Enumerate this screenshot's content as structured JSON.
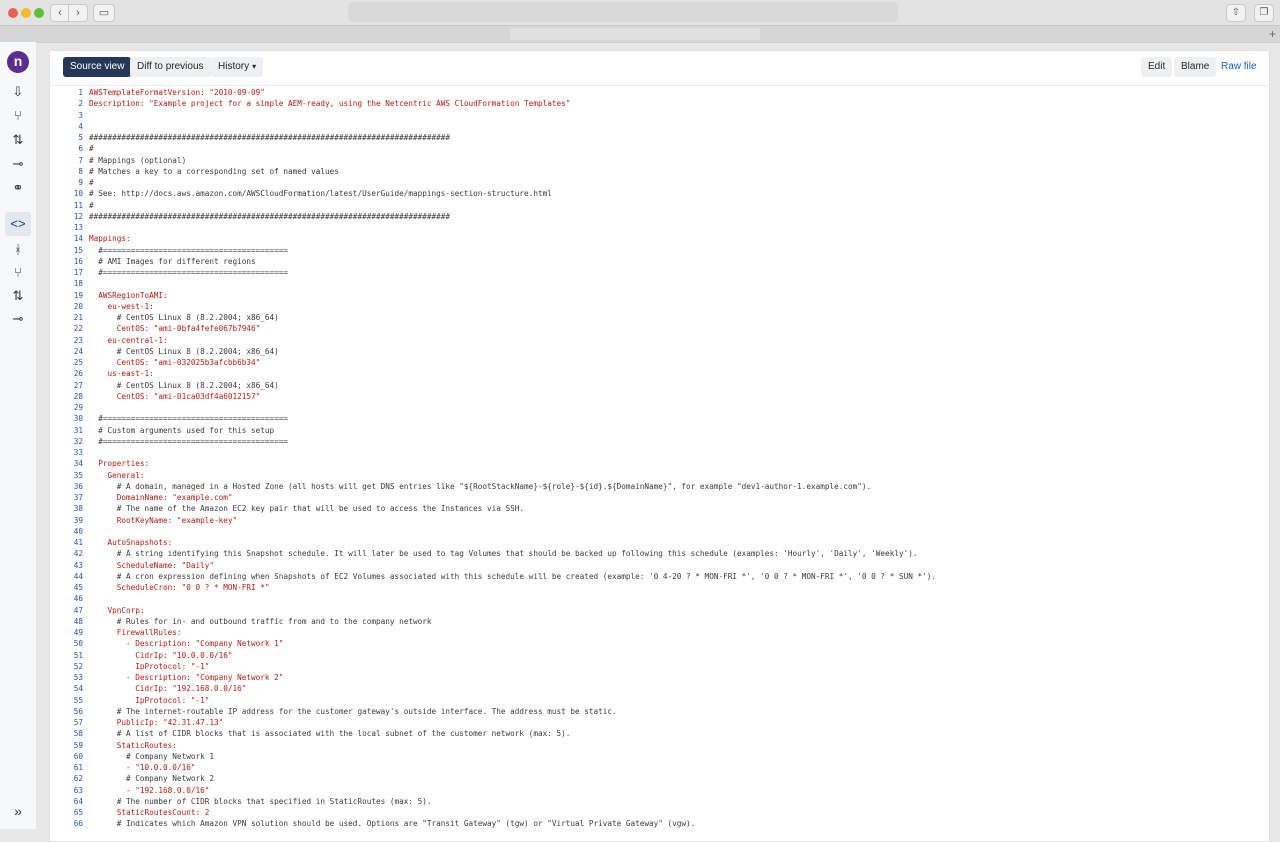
{
  "toolbar": {
    "source_view": "Source view",
    "diff_to_previous": "Diff to previous",
    "history": "History",
    "edit": "Edit",
    "blame": "Blame",
    "raw_file": "Raw file"
  },
  "sidebar": {
    "logo": "n",
    "expand": "»"
  },
  "code_lines": [
    {
      "n": "1",
      "t": "AWSTemplateFormatVersion: \"2010-09-09\"",
      "s": "k"
    },
    {
      "n": "2",
      "t": "Description: \"Example project for a simple AEM-ready, using the Netcentric AWS CloudFormation Templates\"",
      "s": "k"
    },
    {
      "n": "3",
      "t": "",
      "s": "c"
    },
    {
      "n": "4",
      "t": "",
      "s": "c"
    },
    {
      "n": "5",
      "t": "##############################################################################",
      "s": "c"
    },
    {
      "n": "6",
      "t": "#",
      "s": "c"
    },
    {
      "n": "7",
      "t": "# Mappings (optional)",
      "s": "c"
    },
    {
      "n": "8",
      "t": "# Matches a key to a corresponding set of named values",
      "s": "c"
    },
    {
      "n": "9",
      "t": "#",
      "s": "c"
    },
    {
      "n": "10",
      "t": "# See: http://docs.aws.amazon.com/AWSCloudFormation/latest/UserGuide/mappings-section-structure.html",
      "s": "c"
    },
    {
      "n": "11",
      "t": "#",
      "s": "c"
    },
    {
      "n": "12",
      "t": "##############################################################################",
      "s": "c"
    },
    {
      "n": "13",
      "t": "",
      "s": "c"
    },
    {
      "n": "14",
      "t": "Mappings:",
      "s": "k"
    },
    {
      "n": "15",
      "t": "  #========================================",
      "s": "c"
    },
    {
      "n": "16",
      "t": "  # AMI Images for different regions",
      "s": "c"
    },
    {
      "n": "17",
      "t": "  #========================================",
      "s": "c"
    },
    {
      "n": "18",
      "t": "",
      "s": "c"
    },
    {
      "n": "19",
      "t": "  AWSRegionToAMI:",
      "s": "k"
    },
    {
      "n": "20",
      "t": "    eu-west-1:",
      "s": "k"
    },
    {
      "n": "21",
      "t": "      # CentOS Linux 8 (8.2.2004; x86_64)",
      "s": "c"
    },
    {
      "n": "22",
      "t": "      CentOS: \"ami-0bfa4fefe067b7946\"",
      "s": "k"
    },
    {
      "n": "23",
      "t": "    eu-central-1:",
      "s": "k"
    },
    {
      "n": "24",
      "t": "      # CentOS Linux 8 (8.2.2004; x86_64)",
      "s": "c"
    },
    {
      "n": "25",
      "t": "      CentOS: \"ami-032025b3afcbb6b34\"",
      "s": "k"
    },
    {
      "n": "26",
      "t": "    us-east-1:",
      "s": "k"
    },
    {
      "n": "27",
      "t": "      # CentOS Linux 8 (8.2.2004; x86_64)",
      "s": "c"
    },
    {
      "n": "28",
      "t": "      CentOS: \"ami-01ca03df4a6012157\"",
      "s": "k"
    },
    {
      "n": "29",
      "t": "",
      "s": "c"
    },
    {
      "n": "30",
      "t": "  #========================================",
      "s": "c"
    },
    {
      "n": "31",
      "t": "  # Custom arguments used for this setup",
      "s": "c"
    },
    {
      "n": "32",
      "t": "  #========================================",
      "s": "c"
    },
    {
      "n": "33",
      "t": "",
      "s": "c"
    },
    {
      "n": "34",
      "t": "  Properties:",
      "s": "k"
    },
    {
      "n": "35",
      "t": "    General:",
      "s": "k"
    },
    {
      "n": "36",
      "t": "      # A domain, managed in a Hosted Zone (all hosts will get DNS entries like \"${RootStackName}-${role}-${id}.${DomainName}\", for example \"dev1-author-1.example.com\").",
      "s": "c"
    },
    {
      "n": "37",
      "t": "      DomainName: \"example.com\"",
      "s": "k"
    },
    {
      "n": "38",
      "t": "      # The name of the Amazon EC2 key pair that will be used to access the Instances via SSH.",
      "s": "c"
    },
    {
      "n": "39",
      "t": "      RootKeyName: \"example-key\"",
      "s": "k"
    },
    {
      "n": "40",
      "t": "",
      "s": "c"
    },
    {
      "n": "41",
      "t": "    AutoSnapshots:",
      "s": "k"
    },
    {
      "n": "42",
      "t": "      # A string identifying this Snapshot schedule. It will later be used to tag Volumes that should be backed up following this schedule (examples: 'Hourly', 'Daily', 'Weekly').",
      "s": "c"
    },
    {
      "n": "43",
      "t": "      ScheduleName: \"Daily\"",
      "s": "k"
    },
    {
      "n": "44",
      "t": "      # A cron expression defining when Snapshots of EC2 Volumes associated with this schedule will be created (example: '0 4-20 ? * MON-FRI *', '0 0 ? * MON-FRI *', '0 0 ? * SUN *').",
      "s": "c"
    },
    {
      "n": "45",
      "t": "      ScheduleCron: \"0 0 ? * MON-FRI *\"",
      "s": "k"
    },
    {
      "n": "46",
      "t": "",
      "s": "c"
    },
    {
      "n": "47",
      "t": "    VpnCorp:",
      "s": "k"
    },
    {
      "n": "48",
      "t": "      # Rules for in- and outbound traffic from and to the company network",
      "s": "c"
    },
    {
      "n": "49",
      "t": "      FirewallRules:",
      "s": "k"
    },
    {
      "n": "50",
      "t": "        - Description: \"Company Network 1\"",
      "s": "k"
    },
    {
      "n": "51",
      "t": "          CidrIp: \"10.0.0.0/16\"",
      "s": "k"
    },
    {
      "n": "52",
      "t": "          IpProtocol: \"-1\"",
      "s": "k"
    },
    {
      "n": "53",
      "t": "        - Description: \"Company Network 2\"",
      "s": "k"
    },
    {
      "n": "54",
      "t": "          CidrIp: \"192.168.0.0/16\"",
      "s": "k"
    },
    {
      "n": "55",
      "t": "          IpProtocol: \"-1\"",
      "s": "k"
    },
    {
      "n": "56",
      "t": "      # The internet-routable IP address for the customer gateway's outside interface. The address must be static.",
      "s": "c"
    },
    {
      "n": "57",
      "t": "      PublicIp: \"42.31.47.13\"",
      "s": "k"
    },
    {
      "n": "58",
      "t": "      # A list of CIDR blocks that is associated with the local subnet of the customer network (max: 5).",
      "s": "c"
    },
    {
      "n": "59",
      "t": "      StaticRoutes:",
      "s": "k"
    },
    {
      "n": "60",
      "t": "        # Company Network 1",
      "s": "c"
    },
    {
      "n": "61",
      "t": "        - \"10.0.0.0/16\"",
      "s": "k"
    },
    {
      "n": "62",
      "t": "        # Company Network 2",
      "s": "c"
    },
    {
      "n": "63",
      "t": "        - \"192.168.0.0/16\"",
      "s": "k"
    },
    {
      "n": "64",
      "t": "      # The number of CIDR blocks that specified in StaticRoutes (max: 5).",
      "s": "c"
    },
    {
      "n": "65",
      "t": "      StaticRoutesCount: 2",
      "s": "k"
    },
    {
      "n": "66",
      "t": "      # Indicates which Amazon VPN solution should be used. Options are \"Transit Gateway\" (tgw) or \"Virtual Private Gateway\" (vgw).",
      "s": "c"
    }
  ]
}
